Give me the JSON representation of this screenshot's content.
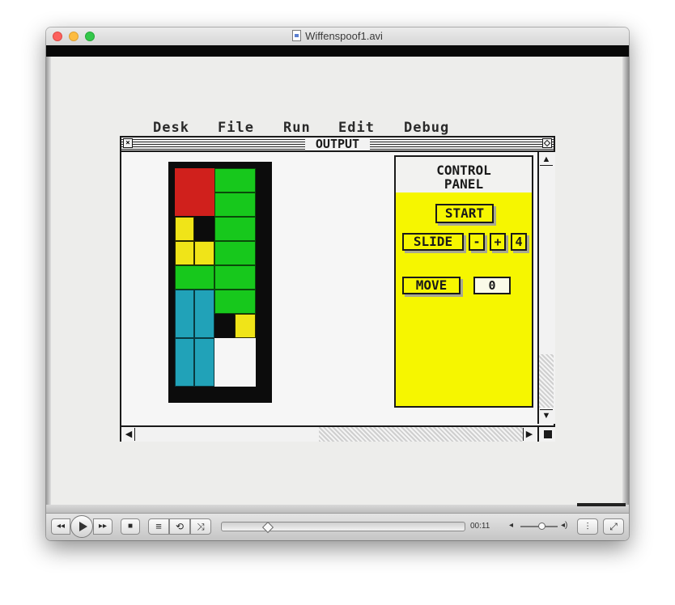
{
  "window": {
    "title": "Wiffenspoof1.avi"
  },
  "video": {
    "menubar": [
      "Desk",
      "File",
      "Run",
      "Edit",
      "Debug"
    ],
    "output_window": {
      "title": "OUTPUT"
    },
    "control_panel": {
      "title_line1": "CONTROL",
      "title_line2": "PANEL",
      "start_label": "START",
      "slide_label": "SLIDE",
      "minus_label": "-",
      "plus_label": "+",
      "slide_value": "4",
      "move_label": "MOVE",
      "move_value": "0"
    },
    "puzzle": {
      "colors": {
        "red": "#d0201c",
        "green": "#17c81c",
        "yellow": "#f0e418",
        "teal": "#21a2b8",
        "black": "#0c0c0c",
        "white": "#f6f6f6"
      }
    }
  },
  "controls": {
    "rewind_icon": "◂◂",
    "forward_icon": "▸▸",
    "stop_icon": "■",
    "playlist_icon": "≡",
    "loop_icon": "⟲",
    "shuffle_icon": "⤨",
    "progress_fraction": 0.18,
    "time": "00:11",
    "volume_fraction": 0.55,
    "volume_low_icon": "◂",
    "volume_high_icon": "◂)",
    "equalizer_icon": "⫶",
    "fullscreen_icon": "⤢"
  }
}
